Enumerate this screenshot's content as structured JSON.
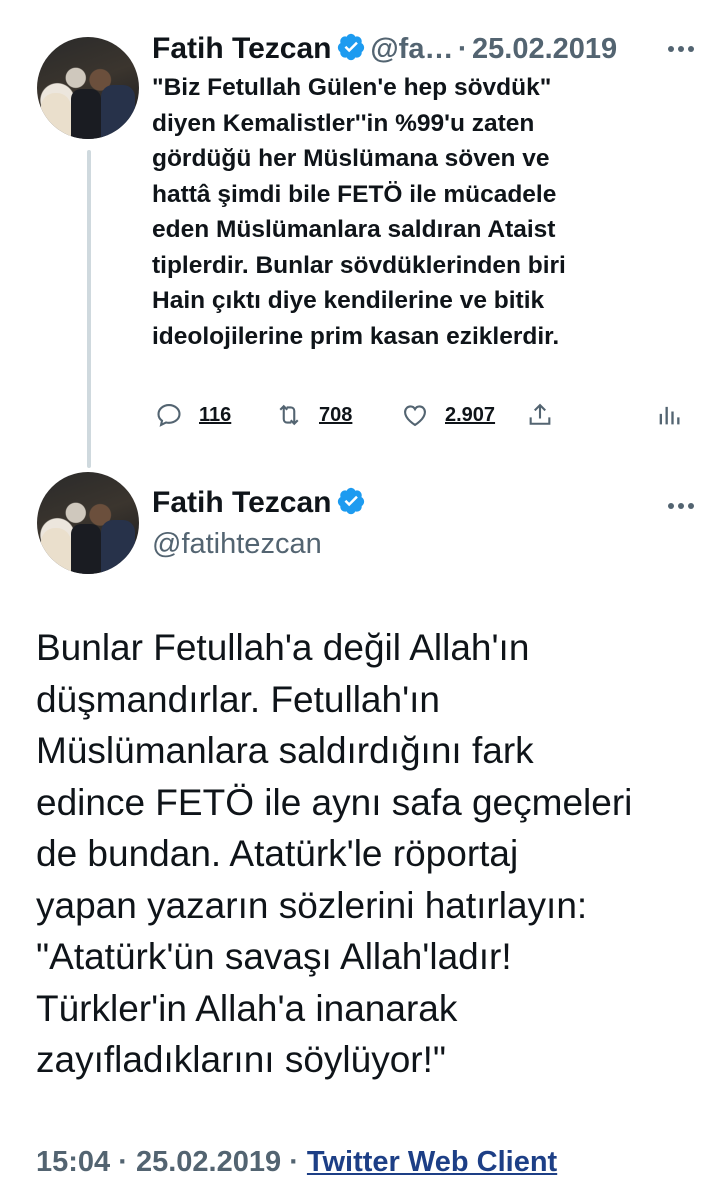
{
  "reply_tweet": {
    "author_name": "Fatih Tezcan",
    "handle_truncated": "@fa…",
    "separator": "·",
    "date": "25.02.2019",
    "text": "\"Biz Fetullah Gülen'e hep sövdük\"\ndiyen Kemalistler''in %99'u zaten\ngördüğü her Müslümana söven ve\nhattâ şimdi bile FETÖ ile mücadele\neden Müslümanlara saldıran Ataist\ntiplerdir. Bunlar sövdüklerinden biri\nHain çıktı diye kendilerine ve bitik\nideolojilerine prim kasan eziklerdir.",
    "replies": "116",
    "retweets": "708",
    "likes": "2.907"
  },
  "main_tweet": {
    "author_name": "Fatih Tezcan",
    "handle": "@fatihtezcan",
    "text": "Bunlar Fetullah'a değil Allah'ın\ndüşmandırlar. Fetullah'ın\nMüslümanlara saldırdığını fark\nedince FETÖ ile aynı safa geçmeleri\nde bundan. Atatürk'le röportaj\nyapan yazarın sözlerini hatırlayın:\n\"Atatürk'ün savaşı Allah'ladır!\nTürkler'in Allah'a inanarak\nzayıfladıklarını söylüyor!\"",
    "time": "15:04",
    "separator": "·",
    "date": "25.02.2019",
    "separator2": "·",
    "client": "Twitter Web Client"
  },
  "icons": {
    "verified": "verified-badge-icon",
    "reply": "reply-icon",
    "retweet": "retweet-icon",
    "like": "heart-icon",
    "share": "share-icon",
    "analytics": "analytics-icon",
    "more": "more-dots-icon"
  },
  "colors": {
    "verified": "#1d9bf0",
    "secondary_text": "#536471",
    "link": "#1d3f86",
    "thread_line": "#cfd9de"
  }
}
